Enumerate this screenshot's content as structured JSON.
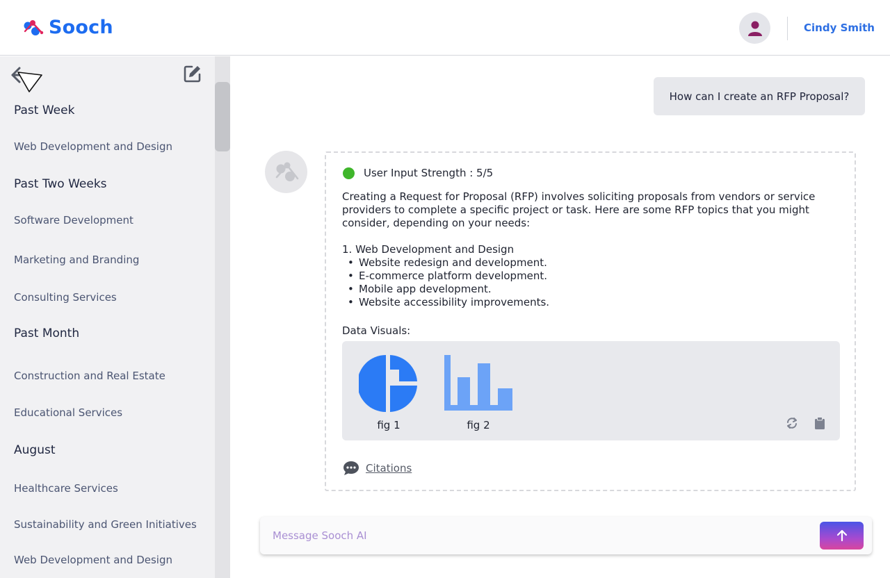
{
  "app": {
    "brand": "Sooch",
    "user_name": "Cindy Smith"
  },
  "sidebar": {
    "groups": [
      {
        "heading": "Past Week",
        "items": [
          "Web Development and Design"
        ]
      },
      {
        "heading": "Past Two Weeks",
        "items": [
          "Software Development",
          "Marketing and Branding",
          "Consulting Services"
        ]
      },
      {
        "heading": "Past Month",
        "items": [
          "Construction and Real Estate",
          "Educational Services"
        ]
      },
      {
        "heading": "August",
        "items": [
          "Healthcare Services",
          "Sustainability and Green Initiatives",
          "Web Development and Design"
        ]
      }
    ]
  },
  "chat": {
    "user_message": "How can I create an RFP Proposal?",
    "answer": {
      "strength": "User Input Strength : 5/5",
      "intro": "Creating a Request for Proposal (RFP) involves soliciting proposals from vendors or service providers to complete a specific project or task. Here are some RFP topics that you might consider, depending on your needs:",
      "list_title": "1. Web Development and Design",
      "bullets": [
        "Website redesign and development.",
        "E-commerce platform development.",
        "Mobile app development.",
        "Website accessibility improvements."
      ],
      "visuals_label": "Data Visuals:",
      "figures": [
        {
          "label": "fig 1",
          "icon": "pie-chart-icon"
        },
        {
          "label": "fig 2",
          "icon": "bar-chart-icon"
        }
      ],
      "citations_label": "Citations"
    }
  },
  "composer": {
    "placeholder": "Message Sooch AI"
  },
  "colors": {
    "brand": "#1d6cf0",
    "user_name": "#2d6fe3",
    "strength_ok": "#3fb62b",
    "chart_blue": "#2b7bf5",
    "chart_blue_light": "#6ca3f7"
  }
}
